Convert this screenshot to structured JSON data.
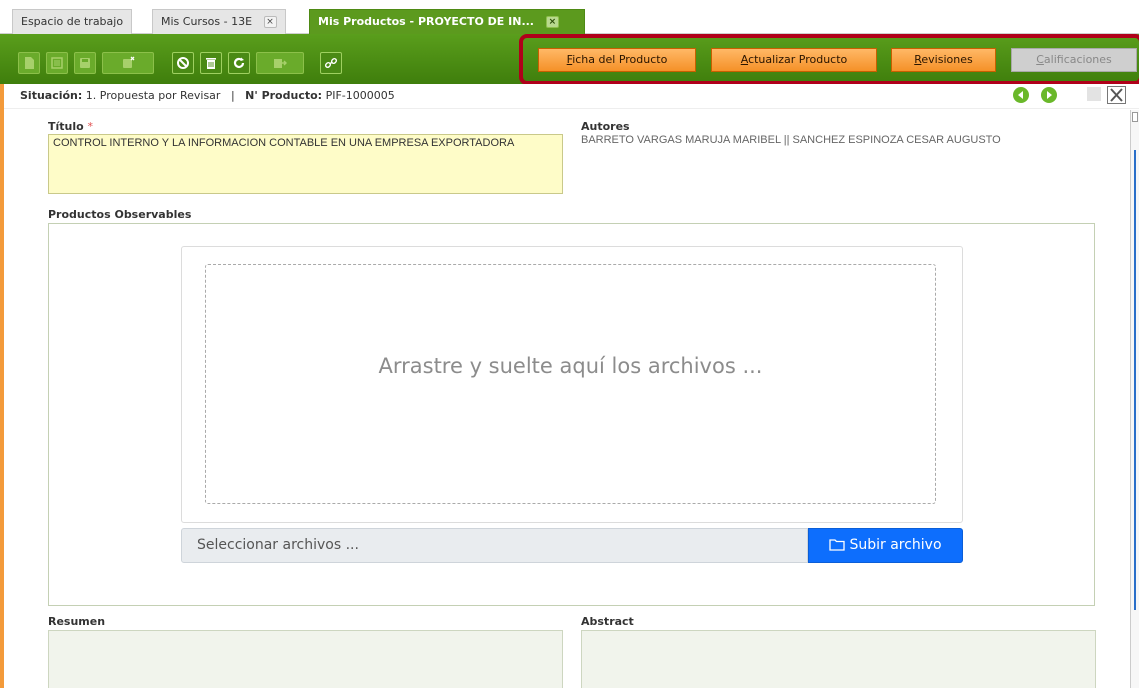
{
  "tabs": [
    {
      "label": "Espacio de trabajo",
      "closable": false
    },
    {
      "label": "Mis Cursos - 13E",
      "closable": true
    },
    {
      "label": "Mis Productos - PROYECTO DE IN...",
      "closable": true,
      "active": true
    }
  ],
  "tab_close_glyph": "×",
  "toolbar": {
    "icons": [
      "new-document-icon",
      "list-icon",
      "save-icon",
      "save-close-icon",
      "cancel-icon",
      "trash-icon",
      "refresh-icon",
      "export-icon",
      "link-icon"
    ]
  },
  "actions": {
    "ficha": {
      "hotkey": "F",
      "rest": "icha del Producto"
    },
    "actualizar": {
      "hotkey": "A",
      "rest": "ctualizar Producto"
    },
    "revisiones": {
      "hotkey": "R",
      "rest": "evisiones"
    },
    "calificaciones": {
      "hotkey": "C",
      "rest": "alificaciones",
      "enabled": false
    }
  },
  "status": {
    "situacion_label": "Situación:",
    "situacion_value": "1. Propuesta por Revisar",
    "separator": "|",
    "producto_label": "N' Producto:",
    "producto_value": "PIF-1000005"
  },
  "form": {
    "titulo_label": "Título",
    "required_mark": "*",
    "titulo_value": "CONTROL INTERNO Y LA INFORMACION CONTABLE EN UNA EMPRESA EXPORTADORA",
    "autores_label": "Autores",
    "autores_value": "BARRETO VARGAS MARUJA MARIBEL || SANCHEZ ESPINOZA CESAR AUGUSTO",
    "productos_label": "Productos Observables",
    "drop_text": "Arrastre y suelte aquí los archivos ...",
    "file_placeholder": "Seleccionar archivos ...",
    "upload_label": "Subir archivo",
    "resumen_label": "Resumen",
    "abstract_label": "Abstract"
  },
  "colors": {
    "toolbar_green": "#4a8a14",
    "tab_active": "#5c9a1e",
    "action_orange": "#f59128",
    "highlight_red": "#b0001a",
    "upload_blue": "#0d6efd",
    "title_bg": "#fefcc8"
  }
}
